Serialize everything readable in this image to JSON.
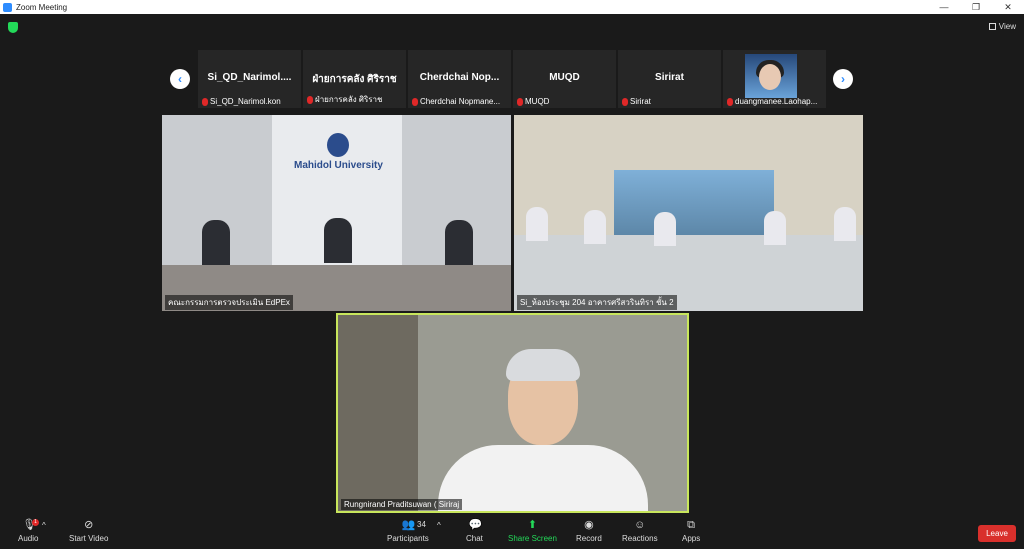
{
  "window": {
    "title": "Zoom Meeting",
    "controls": [
      "—",
      "❐",
      "✕"
    ]
  },
  "topbar": {
    "view_label": "View"
  },
  "participants_strip": [
    {
      "name": "Si_QD_Narimol....",
      "label": "Si_QD_Narimol.kon"
    },
    {
      "name": "ฝ่ายการคลัง ศิริราช",
      "label": "ฝ่ายการคลัง ศิริราช"
    },
    {
      "name": "Cherdchai  Nop...",
      "label": "Cherdchai Nopmane..."
    },
    {
      "name": "MUQD",
      "label": "MUQD"
    },
    {
      "name": "Sirirat",
      "label": "Sirirat"
    },
    {
      "name": "",
      "label": "duangmanee.Laohap..."
    }
  ],
  "videos": {
    "room1": {
      "label": "คณะกรรมการตรวจประเมิน EdPEx",
      "logo": "Mahidol University"
    },
    "room2": {
      "label": "Si_ห้องประชุม 204 อาคารศรีสวรินทิรา ชั้น 2"
    },
    "speaker": {
      "label": "Rungnirand Praditsuwan ( Siriraj"
    }
  },
  "toolbar": {
    "audio": "Audio",
    "start_video": "Start Video",
    "participants": "Participants",
    "participants_count": "34",
    "chat": "Chat",
    "share_screen": "Share Screen",
    "record": "Record",
    "reactions": "Reactions",
    "apps": "Apps",
    "leave": "Leave",
    "audio_badge": "1"
  },
  "colors": {
    "accent": "#2d8cff",
    "leave": "#d9302c",
    "active_speaker_border": "#c8e65c",
    "share_green": "#23d959"
  }
}
